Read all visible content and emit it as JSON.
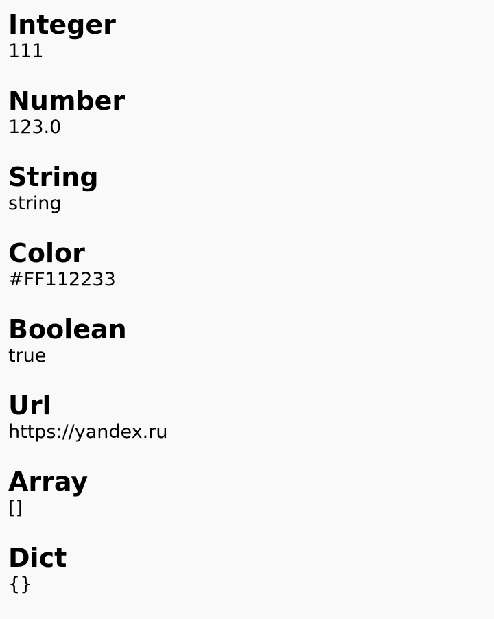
{
  "entries": [
    {
      "label": "Integer",
      "value": "111"
    },
    {
      "label": "Number",
      "value": "123.0"
    },
    {
      "label": "String",
      "value": "string"
    },
    {
      "label": "Color",
      "value": "#FF112233"
    },
    {
      "label": "Boolean",
      "value": "true"
    },
    {
      "label": "Url",
      "value": "https://yandex.ru"
    },
    {
      "label": "Array",
      "value": "[]"
    },
    {
      "label": "Dict",
      "value": "{}"
    }
  ]
}
